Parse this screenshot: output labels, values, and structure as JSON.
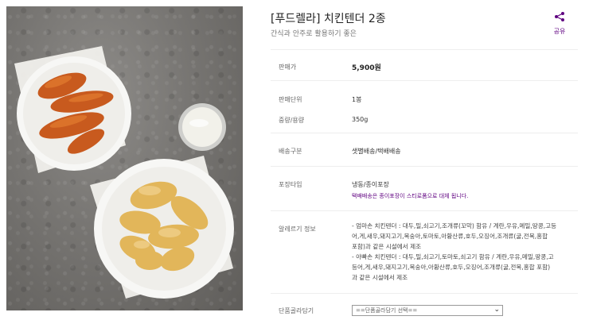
{
  "product": {
    "title": "[푸드렐라] 치킨텐더 2종",
    "subtitle": "간식과 안주로 활용하기 좋은"
  },
  "share": {
    "label": "공유",
    "icon": "share-icon"
  },
  "colors": {
    "accent": "#5f0080"
  },
  "details": {
    "price_label": "판매가",
    "price_value": "5,900원",
    "unit_label": "판매단위",
    "unit_value": "1봉",
    "weight_label": "중량/용량",
    "weight_value": "350g",
    "delivery_label": "배송구분",
    "delivery_value": "샛별배송/택배배송",
    "package_label": "포장타입",
    "package_value": "냉동/종이포장",
    "package_note": "택배배송은 종이포장이 스티로폼으로 대체 됩니다.",
    "allergy_label": "알레르기 정보",
    "allergy_lines": [
      "- 엄마손 치킨텐더 : 대두,밀,쇠고기,조개류(꼬막) 함유 / 계란,우유,메밀,땅콩,고등",
      "어,게,새우,돼지고기,복숭아,토마토,아황산류,호두,오징어,조개류(굴,전복,홍합",
      "포함)과 같은 시설에서 제조",
      "- 아빠손 치킨텐더 : 대두,밀,쇠고기,토마토,쇠고기 함유 / 계란,우유,메밀,땅콩,고",
      "등어,게,새우,돼지고기,복숭아,아황산류,호두,오징어,조개류(굴,전복,홍합 포함)",
      "과 같은 시설에서 제조"
    ],
    "select_label": "단품골라담기",
    "select_value": "==단품골라담기 선택=="
  }
}
